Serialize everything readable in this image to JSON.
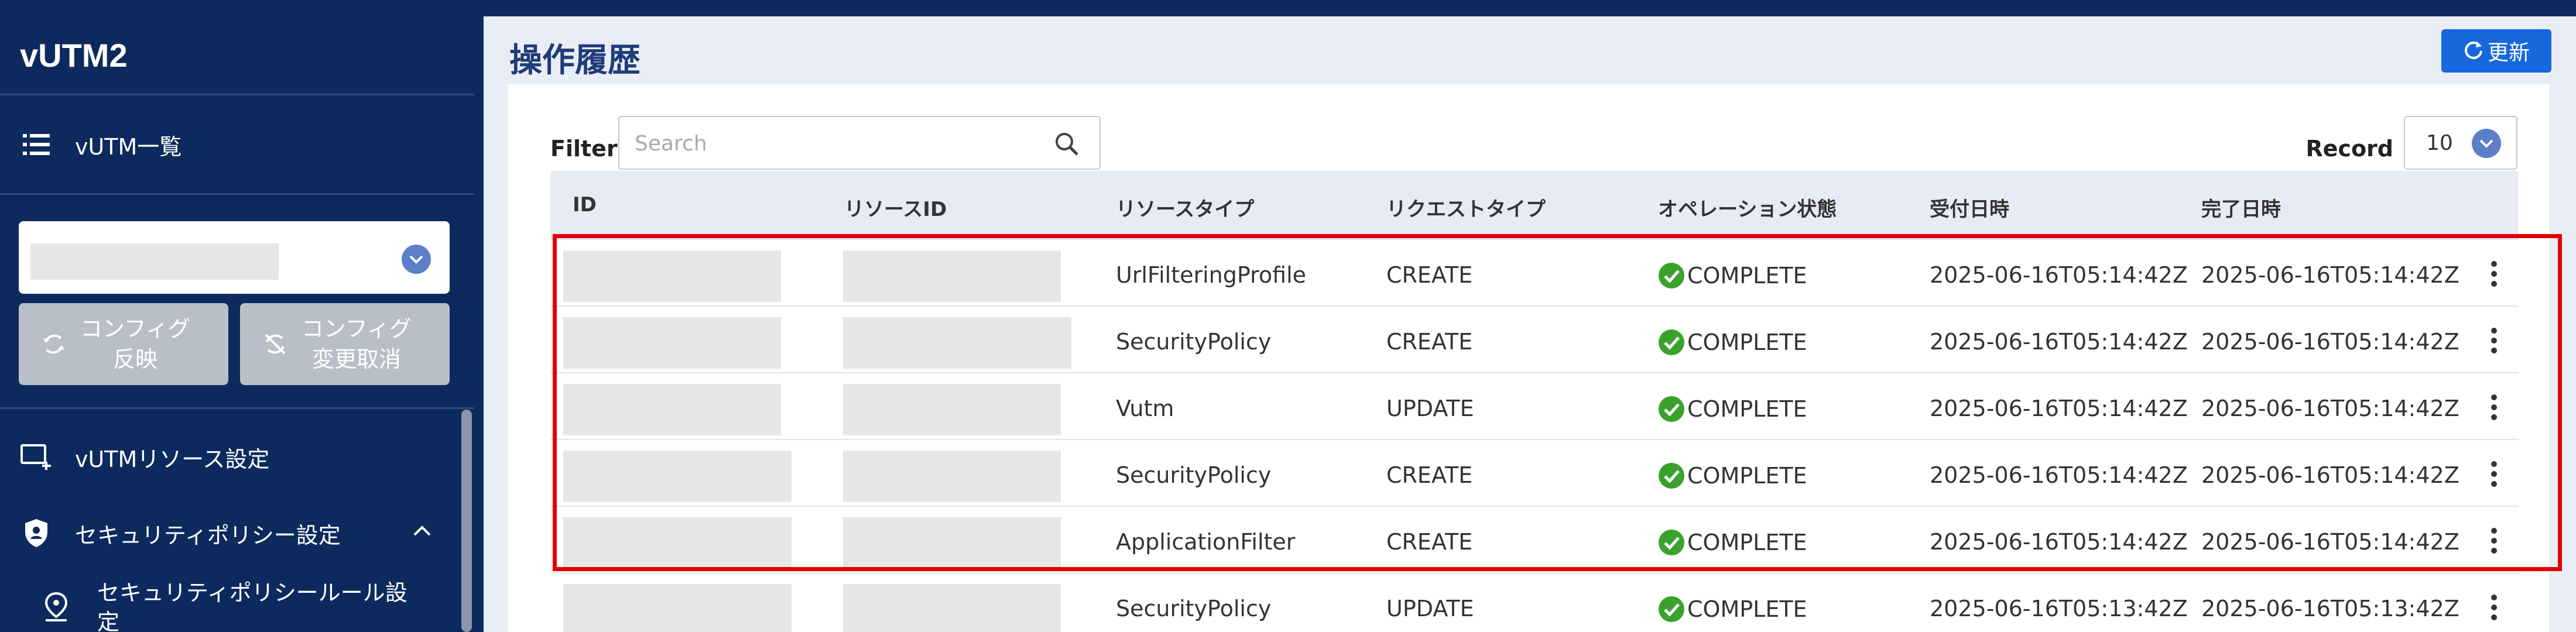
{
  "app": {
    "title": "vUTM2"
  },
  "sidebar": {
    "list_item": "vUTM一覧",
    "apply_button": [
      "コンフィグ",
      "反映"
    ],
    "cancel_button": [
      "コンフィグ",
      "変更取消"
    ],
    "resource_settings": "vUTMリソース設定",
    "security_policy": "セキュリティポリシー設定",
    "security_rule": "セキュリティポリシールール設定"
  },
  "main": {
    "title": "操作履歴",
    "refresh_label": "更新",
    "filter_label": "Filter",
    "search_placeholder": "Search",
    "record_label": "Record",
    "record_value": "10"
  },
  "table": {
    "headers": [
      "ID",
      "リソースID",
      "リソースタイプ",
      "リクエストタイプ",
      "オペレーション状態",
      "受付日時",
      "完了日時"
    ],
    "rows": [
      {
        "type": "UrlFilteringProfile",
        "request": "CREATE",
        "status": "COMPLETE",
        "received": "2025-06-16T05:14:42Z",
        "completed": "2025-06-16T05:14:42Z"
      },
      {
        "type": "SecurityPolicy",
        "request": "CREATE",
        "status": "COMPLETE",
        "received": "2025-06-16T05:14:42Z",
        "completed": "2025-06-16T05:14:42Z"
      },
      {
        "type": "Vutm",
        "request": "UPDATE",
        "status": "COMPLETE",
        "received": "2025-06-16T05:14:42Z",
        "completed": "2025-06-16T05:14:42Z"
      },
      {
        "type": "SecurityPolicy",
        "request": "CREATE",
        "status": "COMPLETE",
        "received": "2025-06-16T05:14:42Z",
        "completed": "2025-06-16T05:14:42Z"
      },
      {
        "type": "ApplicationFilter",
        "request": "CREATE",
        "status": "COMPLETE",
        "received": "2025-06-16T05:14:42Z",
        "completed": "2025-06-16T05:14:42Z"
      },
      {
        "type": "SecurityPolicy",
        "request": "UPDATE",
        "status": "COMPLETE",
        "received": "2025-06-16T05:13:42Z",
        "completed": "2025-06-16T05:13:42Z"
      }
    ]
  },
  "colors": {
    "sidebar_bg": "#0d2a5e",
    "accent": "#1668dc",
    "status_ok": "#3aa22c",
    "highlight": "#e00000"
  }
}
